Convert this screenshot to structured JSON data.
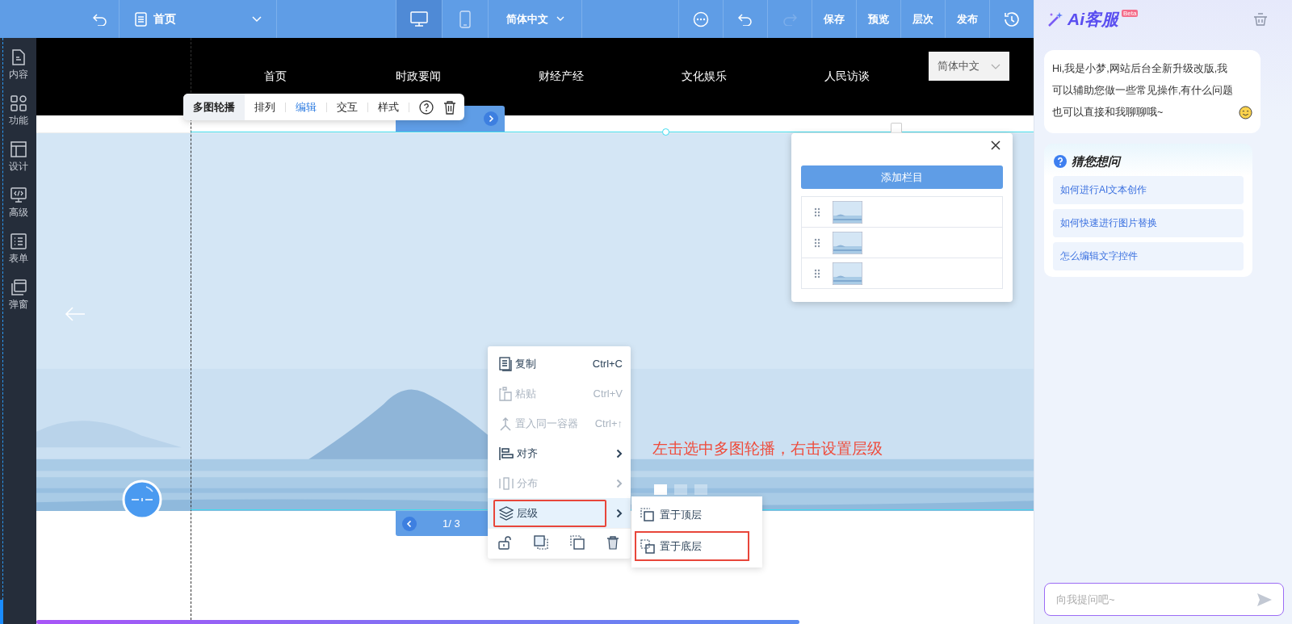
{
  "top_bar": {
    "page_select": "首页",
    "devices": [
      {
        "kind": "desktop",
        "selected": true
      },
      {
        "kind": "mobile",
        "selected": false
      }
    ],
    "language": "简体中文",
    "actions": [
      {
        "kind": "more",
        "disabled": false
      },
      {
        "kind": "undo",
        "disabled": false
      },
      {
        "kind": "redo",
        "disabled": true
      },
      {
        "kind": "text",
        "label": "保存",
        "disabled": false
      },
      {
        "kind": "text",
        "label": "预览",
        "disabled": false
      },
      {
        "kind": "text",
        "label": "层次",
        "disabled": false
      },
      {
        "kind": "text",
        "label": "发布",
        "disabled": false
      },
      {
        "kind": "history",
        "disabled": false
      }
    ]
  },
  "sidebar": {
    "items": [
      {
        "kind": "content",
        "label": "内容"
      },
      {
        "kind": "function",
        "label": "功能"
      },
      {
        "kind": "design",
        "label": "设计"
      },
      {
        "kind": "advanced",
        "label": "高级"
      },
      {
        "kind": "form",
        "label": "表单"
      },
      {
        "kind": "popup",
        "label": "弹窗"
      }
    ]
  },
  "site_nav": {
    "items": [
      "首页",
      "时政要闻",
      "财经产经",
      "文化娱乐",
      "人民访谈"
    ],
    "language": "简体中文"
  },
  "element_toolbar": {
    "title": "多图轮播",
    "tabs": [
      {
        "label": "排列",
        "selected": false
      },
      {
        "label": "编辑",
        "selected": true
      },
      {
        "label": "交互",
        "selected": false
      },
      {
        "label": "样式",
        "selected": false
      }
    ]
  },
  "carousel": {
    "kind": "picture",
    "pager": "1/ 3",
    "dots": [
      {
        "selected": true
      },
      {
        "selected": false
      },
      {
        "selected": false
      }
    ]
  },
  "context_menu": {
    "items": [
      {
        "kind": "copy",
        "label": "复制",
        "shortcut": "Ctrl+C",
        "disabled": false,
        "submenu": false,
        "highlighted": false
      },
      {
        "kind": "paste",
        "label": "粘贴",
        "shortcut": "Ctrl+V",
        "disabled": true,
        "submenu": false,
        "highlighted": false
      },
      {
        "kind": "container",
        "label": "置入同一容器",
        "shortcut": "Ctrl+↑",
        "disabled": true,
        "submenu": false,
        "highlighted": false
      },
      {
        "kind": "align",
        "label": "对齐",
        "disabled": false,
        "submenu": true,
        "highlighted": false
      },
      {
        "kind": "distribute",
        "label": "分布",
        "disabled": true,
        "submenu": true,
        "highlighted": false
      },
      {
        "kind": "layer",
        "label": "层级",
        "disabled": false,
        "submenu": true,
        "highlighted": true
      }
    ],
    "icon_buttons": [
      {
        "kind": "unlock"
      },
      {
        "kind": "forward"
      },
      {
        "kind": "backward"
      },
      {
        "kind": "delete"
      }
    ],
    "submenu": [
      {
        "kind": "top",
        "label": "置于顶层",
        "highlighted": false
      },
      {
        "kind": "bottom",
        "label": "置于底层",
        "highlighted": true
      }
    ]
  },
  "annotation": "左击选中多图轮播，右击设置层级",
  "column_panel": {
    "button": "添加栏目"
  },
  "ai_panel": {
    "logo": "Ai客服",
    "badge": "Beta",
    "greeting": "Hi,我是小梦,网站后台全新升级改版,我可以辅助您做一些常见操作,有什么问题也可以直接和我聊聊哦~",
    "suggestions": {
      "title": "猜您想问",
      "items": [
        "如何进行AI文本创作",
        "如何快速进行图片替换",
        "怎么编辑文字控件"
      ]
    },
    "input": {
      "placeholder": "向我提问吧~"
    }
  }
}
